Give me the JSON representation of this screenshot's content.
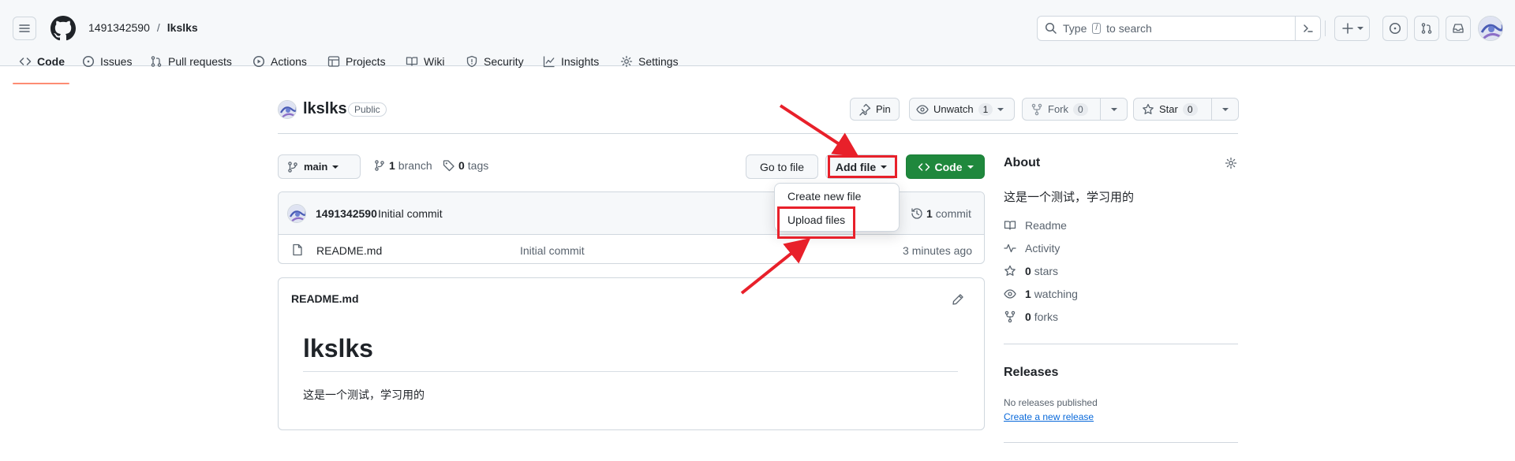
{
  "header": {
    "owner": "1491342590",
    "separator": "/",
    "repo": "lkslks",
    "search_placeholder_pre": "Type",
    "search_placeholder_key": "/",
    "search_placeholder_post": "to search"
  },
  "nav": {
    "tabs": [
      {
        "label": "Code"
      },
      {
        "label": "Issues"
      },
      {
        "label": "Pull requests"
      },
      {
        "label": "Actions"
      },
      {
        "label": "Projects"
      },
      {
        "label": "Wiki"
      },
      {
        "label": "Security"
      },
      {
        "label": "Insights"
      },
      {
        "label": "Settings"
      }
    ]
  },
  "repo_header": {
    "name": "lkslks",
    "visibility": "Public",
    "pin_label": "Pin",
    "unwatch_label": "Unwatch",
    "unwatch_count": "1",
    "fork_label": "Fork",
    "fork_count": "0",
    "star_label": "Star",
    "star_count": "0"
  },
  "toolbar": {
    "branch": "main",
    "branch_count": "1",
    "branch_word": "branch",
    "tag_count": "0",
    "tag_word": "tags",
    "go_to_file": "Go to file",
    "add_file": "Add file",
    "code": "Code"
  },
  "dropdown": {
    "items": [
      {
        "label": "Create new file"
      },
      {
        "label": "Upload files"
      }
    ]
  },
  "commit_bar": {
    "author": "1491342590",
    "message": "Initial commit",
    "commit_count": "1",
    "commit_word": "commit"
  },
  "files": [
    {
      "name": "README.md",
      "message": "Initial commit",
      "time": "3 minutes ago"
    }
  ],
  "readme": {
    "filename": "README.md",
    "heading": "lkslks",
    "body": "这是一个测试，学习用的"
  },
  "about": {
    "title": "About",
    "description": "这是一个测试，学习用的",
    "readme": "Readme",
    "activity": "Activity",
    "stars_count": "0",
    "stars_word": "stars",
    "watching_count": "1",
    "watching_word": "watching",
    "forks_count": "0",
    "forks_word": "forks"
  },
  "releases": {
    "title": "Releases",
    "none_text": "No releases published",
    "create_link": "Create a new release"
  },
  "colors": {
    "accent_underline": "#fd8c73",
    "primary_green": "#1f883d",
    "annotation_red": "#e8202a",
    "link_blue": "#0969da"
  }
}
